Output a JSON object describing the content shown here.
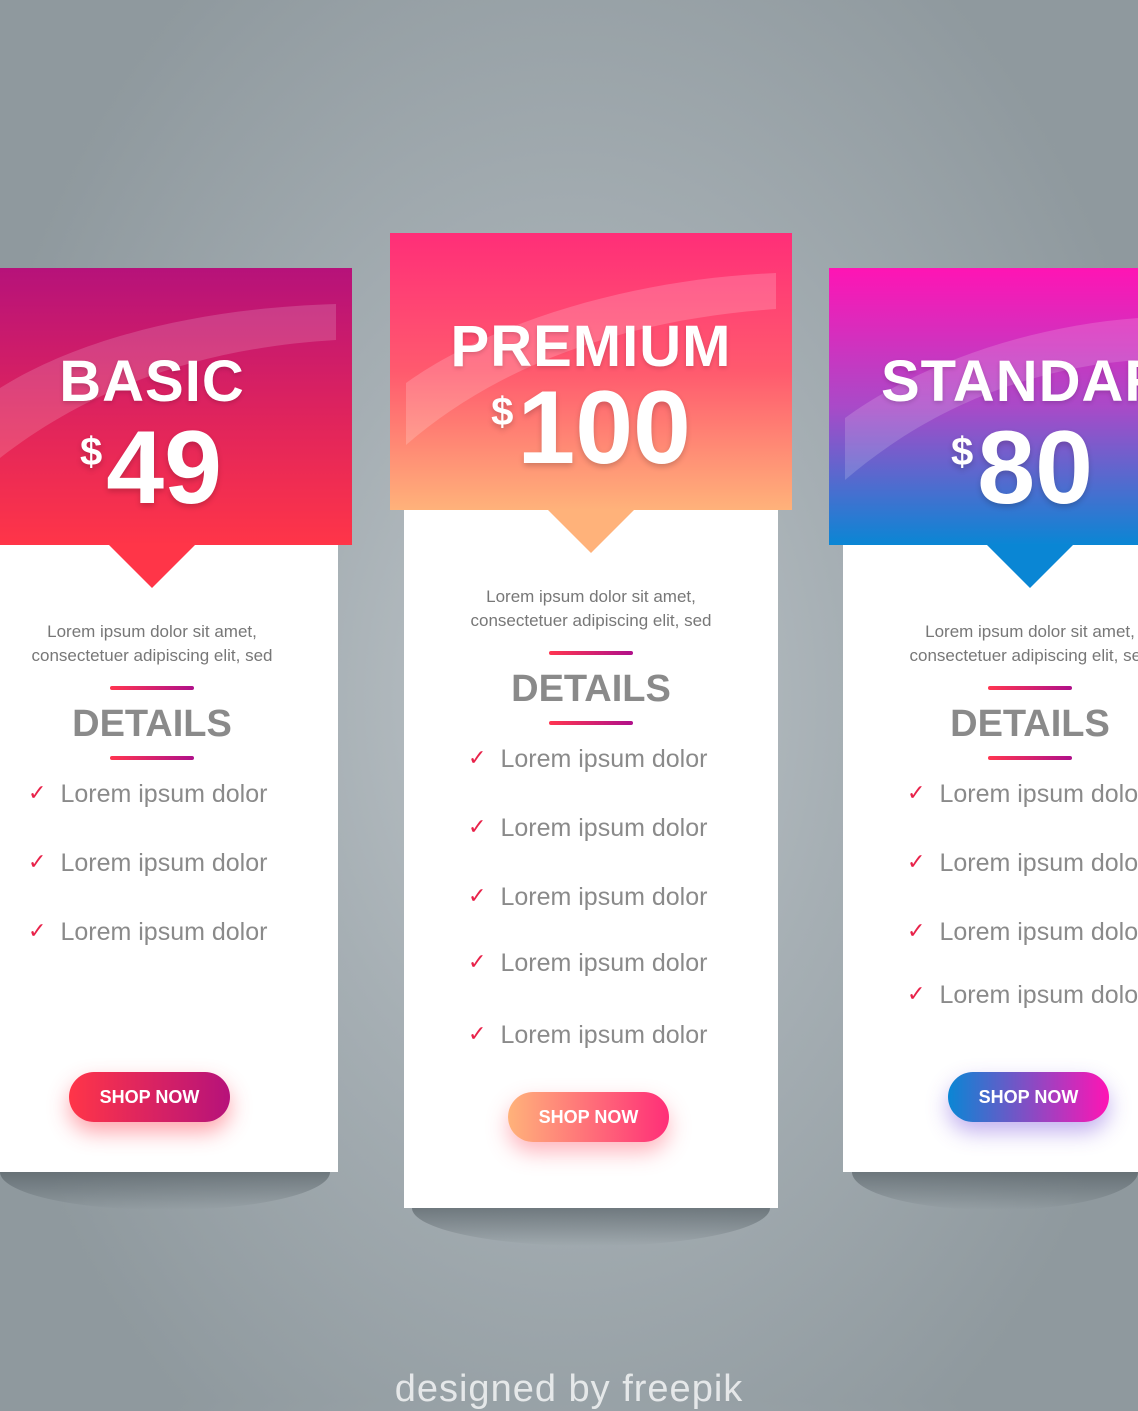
{
  "plans": [
    {
      "name": "BASIC",
      "currency": "$",
      "amount": "49",
      "description_line1": "Lorem ipsum dolor sit amet,",
      "description_line2": "consectetuer adipiscing elit, sed",
      "details_heading": "DETAILS",
      "features": [
        "Lorem ipsum dolor",
        "Lorem ipsum dolor",
        "Lorem ipsum dolor"
      ],
      "button_label": "SHOP NOW",
      "colors": {
        "header_top": "#b6127a",
        "header_bottom": "#ff3548",
        "button_from": "#ff3548",
        "button_to": "#b6127a"
      }
    },
    {
      "name": "PREMIUM",
      "currency": "$",
      "amount": "100",
      "description_line1": "Lorem ipsum dolor sit amet,",
      "description_line2": "consectetuer adipiscing elit, sed",
      "details_heading": "DETAILS",
      "features": [
        "Lorem ipsum dolor",
        "Lorem ipsum dolor",
        "Lorem ipsum dolor",
        "Lorem ipsum dolor",
        "Lorem ipsum dolor"
      ],
      "button_label": "SHOP NOW",
      "colors": {
        "header_top": "#ff2e78",
        "header_bottom": "#ffb27a",
        "button_from": "#ffb27a",
        "button_to": "#ff2e78"
      }
    },
    {
      "name": "STANDARD",
      "currency": "$",
      "amount": "80",
      "description_line1": "Lorem ipsum dolor sit amet,",
      "description_line2": "consectetuer adipiscing elit, sed",
      "details_heading": "DETAILS",
      "features": [
        "Lorem ipsum dolor",
        "Lorem ipsum dolor",
        "Lorem ipsum dolor",
        "Lorem ipsum dolor"
      ],
      "button_label": "SHOP NOW",
      "colors": {
        "header_top": "#ff14b4",
        "header_bottom": "#0a86d4",
        "button_from": "#0a86d4",
        "button_to": "#ff14b4"
      }
    }
  ],
  "credit": "designed by  freepik"
}
